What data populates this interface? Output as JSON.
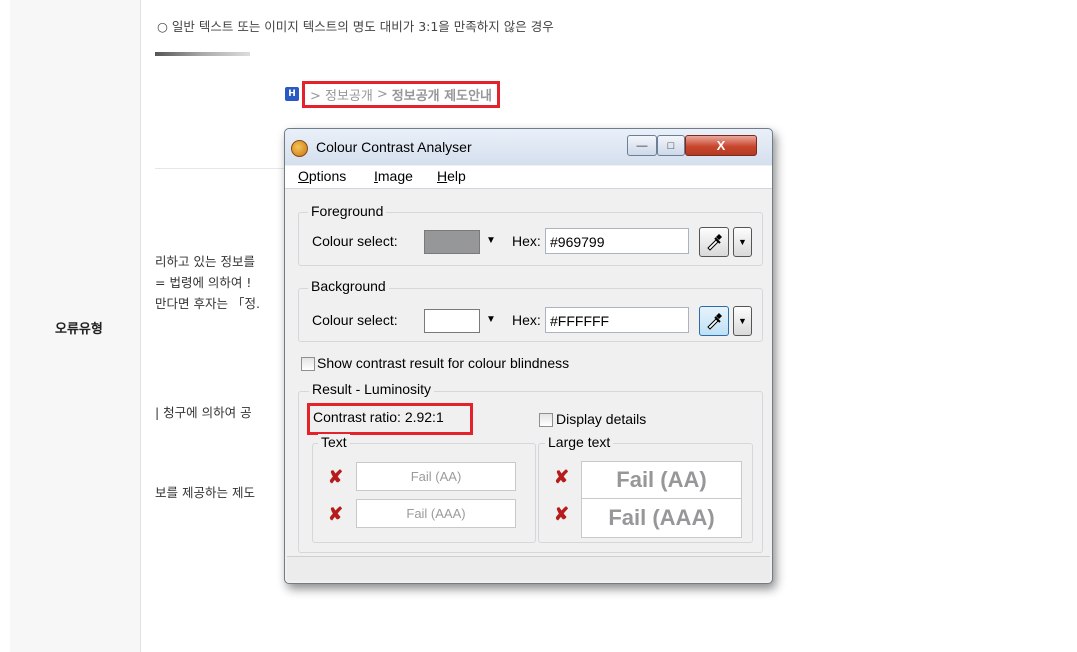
{
  "page": {
    "category_label": "오류유형",
    "description": "○ 일반 텍스트 또는 이미지 텍스트의 명도 대비가 3:1을 만족하지 않은 경우"
  },
  "website": {
    "breadcrumb": {
      "home_icon": "H",
      "path_1": "> 정보공개",
      "separator": ">",
      "current": "정보공개 제도안내"
    },
    "fragments": [
      "리하고 있는 정보를",
      "= 법령에 의하여 !",
      "만다면 후자는 「정.",
      "| 청구에 의하여 공",
      "보를 제공하는 제도"
    ]
  },
  "dialog": {
    "title": "Colour Contrast Analyser",
    "window_buttons": {
      "minimize": "—",
      "maximize": "□",
      "close": "X"
    },
    "menu": [
      "Options",
      "Image",
      "Help"
    ],
    "menu_mnemonics": [
      "O",
      "I",
      "H"
    ],
    "foreground": {
      "group_title": "Foreground",
      "colour_select_label": "Colour select:",
      "swatch_color": "#969799",
      "hex_label": "Hex:",
      "hex_value": "#969799"
    },
    "background": {
      "group_title": "Background",
      "colour_select_label": "Colour select:",
      "swatch_color": "#FFFFFF",
      "hex_label": "Hex:",
      "hex_value": "#FFFFFF"
    },
    "colour_blindness_checkbox": "Show contrast result for colour blindness",
    "result": {
      "group_title": "Result - Luminosity",
      "contrast_ratio": "Contrast ratio: 2.92:1",
      "display_details_label": "Display details",
      "text_group_title": "Text",
      "large_text_group_title": "Large text",
      "text_results": [
        "Fail (AA)",
        "Fail (AAA)"
      ],
      "large_text_results": [
        "Fail (AA)",
        "Fail (AAA)"
      ],
      "fail_icon": "✘"
    },
    "colors": {
      "highlight": "#e4222b",
      "fail_icon": "#b71c1c"
    }
  }
}
